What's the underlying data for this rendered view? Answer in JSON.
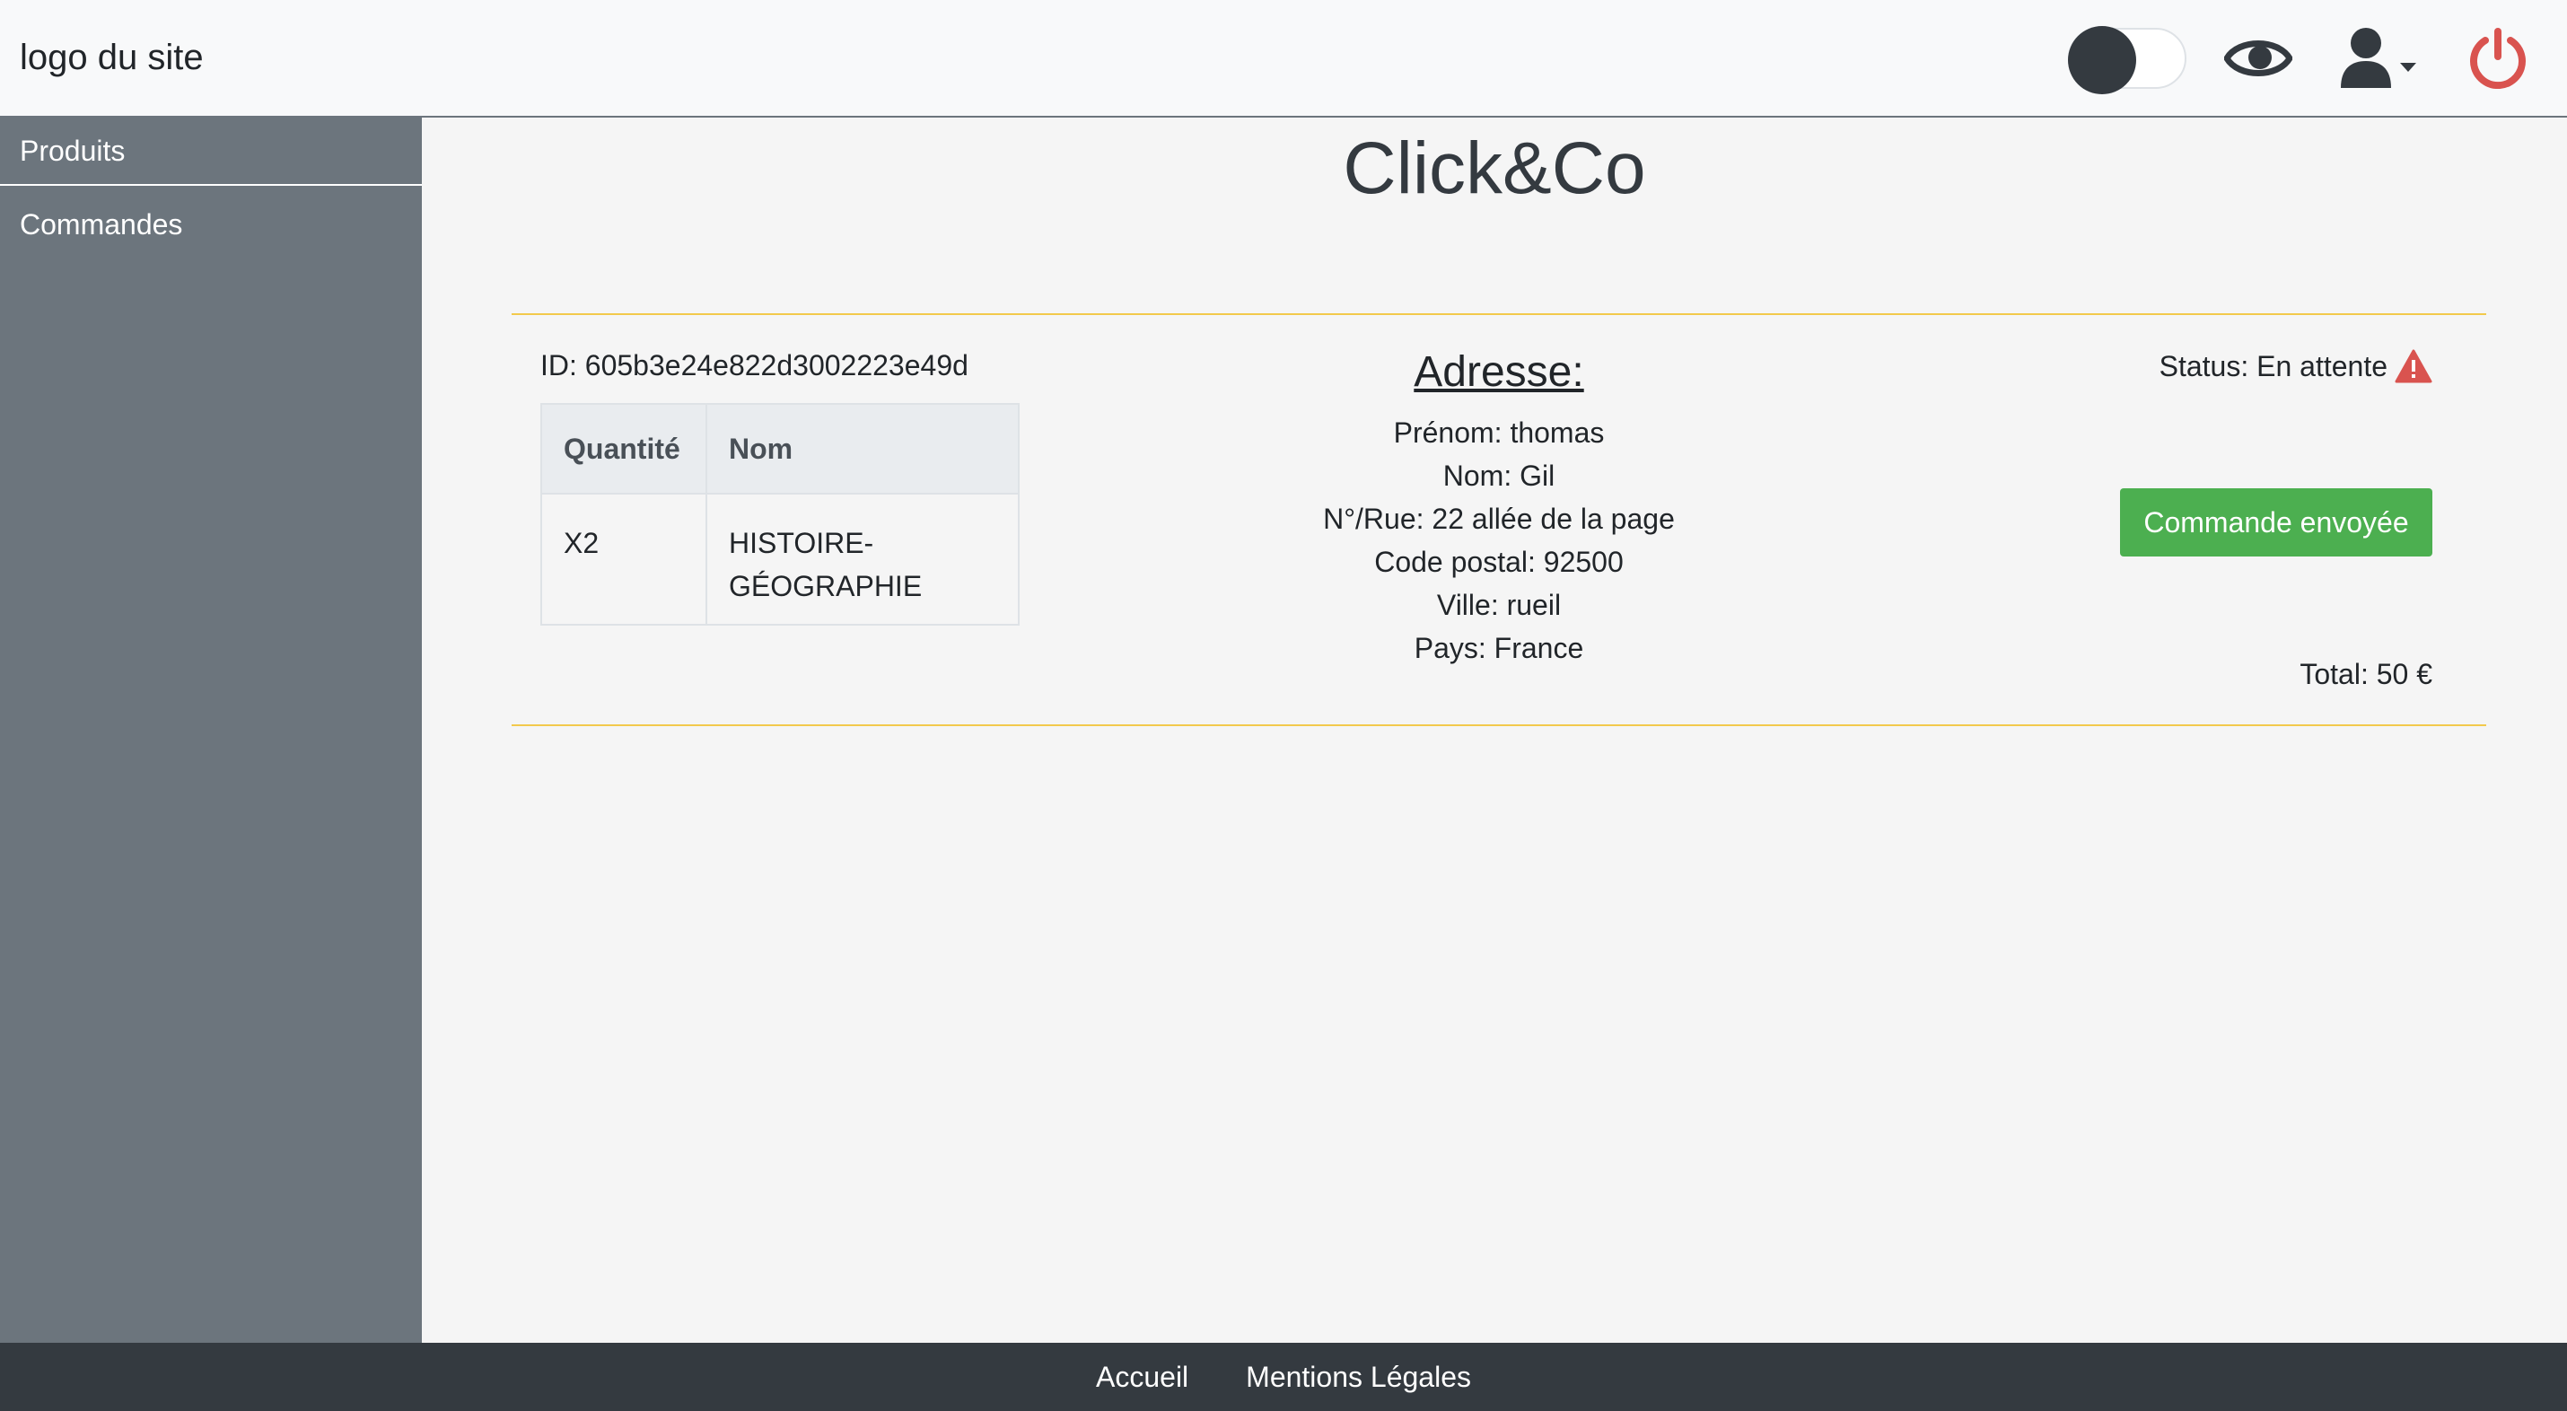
{
  "header": {
    "logo": "logo du site",
    "theme_toggle_on": false,
    "icons": [
      "eye-icon",
      "user-icon",
      "power-icon"
    ],
    "colors": {
      "power": "#d9534f",
      "icons": "#343a40"
    }
  },
  "sidebar": {
    "items": [
      {
        "label": "Produits"
      },
      {
        "label": "Commandes"
      }
    ]
  },
  "main": {
    "title": "Click&Co",
    "order": {
      "id_text": "ID: 605b3e24e822d3002223e49d",
      "table": {
        "headers": [
          "Quantité",
          "Nom"
        ],
        "rows": [
          {
            "qty": "X2",
            "name_line1": "HISTOIRE-",
            "name_line2": "GÉOGRAPHIE"
          }
        ]
      },
      "address": {
        "title": "Adresse:",
        "firstname": "Prénom: thomas",
        "lastname": "Nom: Gil",
        "street": "N°/Rue: 22 allée de la page",
        "postal": "Code postal: 92500",
        "city": "Ville: rueil",
        "country": "Pays: France"
      },
      "status": "Status: En attente",
      "status_icon": "warning-icon",
      "status_color": "#d9534f",
      "send_button": "Commande envoyée",
      "send_button_color": "#4caf50",
      "total": "Total: 50 €"
    }
  },
  "footer": {
    "links": [
      "Accueil",
      "Mentions Légales"
    ]
  }
}
